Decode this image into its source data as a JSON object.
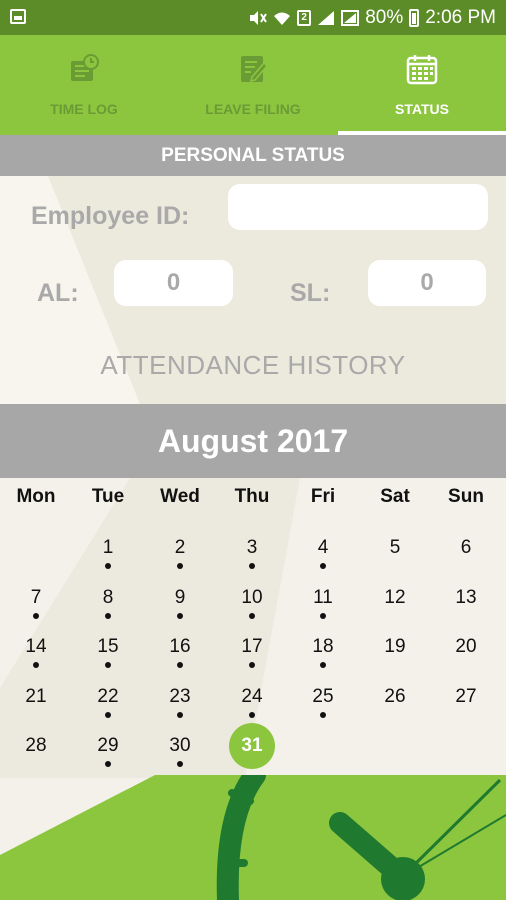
{
  "status_bar": {
    "battery": "80%",
    "time": "2:06 PM",
    "sim_badge": "2",
    "icons": [
      "screenshot-icon",
      "mute-icon",
      "wifi-icon",
      "sim-2-icon",
      "signal-icon",
      "signal-2-icon",
      "battery-icon"
    ]
  },
  "tabs": [
    {
      "label": "TIME LOG",
      "icon": "time-log-icon",
      "active": false
    },
    {
      "label": "LEAVE FILING",
      "icon": "leave-filing-icon",
      "active": false
    },
    {
      "label": "STATUS",
      "icon": "calendar-icon",
      "active": true
    }
  ],
  "personal_status": {
    "header": "PERSONAL STATUS",
    "employee_id_label": "Employee ID:",
    "employee_id_value": "",
    "al_label": "AL:",
    "al_value": "0",
    "sl_label": "SL:",
    "sl_value": "0"
  },
  "attendance": {
    "title": "ATTENDANCE HISTORY",
    "month": "August 2017",
    "weekdays": [
      "Mon",
      "Tue",
      "Wed",
      "Thu",
      "Fri",
      "Sat",
      "Sun"
    ],
    "weeks": [
      [
        {
          "d": "",
          "dot": false
        },
        {
          "d": "1",
          "dot": true
        },
        {
          "d": "2",
          "dot": true
        },
        {
          "d": "3",
          "dot": true
        },
        {
          "d": "4",
          "dot": true
        },
        {
          "d": "5",
          "dot": false
        },
        {
          "d": "6",
          "dot": false
        }
      ],
      [
        {
          "d": "7",
          "dot": true
        },
        {
          "d": "8",
          "dot": true
        },
        {
          "d": "9",
          "dot": true
        },
        {
          "d": "10",
          "dot": true
        },
        {
          "d": "11",
          "dot": true
        },
        {
          "d": "12",
          "dot": false
        },
        {
          "d": "13",
          "dot": false
        }
      ],
      [
        {
          "d": "14",
          "dot": true
        },
        {
          "d": "15",
          "dot": true
        },
        {
          "d": "16",
          "dot": true
        },
        {
          "d": "17",
          "dot": true
        },
        {
          "d": "18",
          "dot": true
        },
        {
          "d": "19",
          "dot": false
        },
        {
          "d": "20",
          "dot": false
        }
      ],
      [
        {
          "d": "21",
          "dot": false
        },
        {
          "d": "22",
          "dot": true
        },
        {
          "d": "23",
          "dot": true
        },
        {
          "d": "24",
          "dot": true
        },
        {
          "d": "25",
          "dot": true
        },
        {
          "d": "26",
          "dot": false
        },
        {
          "d": "27",
          "dot": false
        }
      ],
      [
        {
          "d": "28",
          "dot": false
        },
        {
          "d": "29",
          "dot": true
        },
        {
          "d": "30",
          "dot": true
        },
        {
          "d": "31",
          "dot": false,
          "today": true
        },
        {
          "d": "",
          "dot": false
        },
        {
          "d": "",
          "dot": false
        },
        {
          "d": "",
          "dot": false
        }
      ]
    ]
  },
  "colors": {
    "status_bar": "#5c8c28",
    "accent": "#8cc63f",
    "tab_inactive_text": "#6b9b35",
    "section_gray": "#a7a7a7",
    "label_gray": "#a9a9a9",
    "clock_dark_green": "#1f7a2f"
  }
}
